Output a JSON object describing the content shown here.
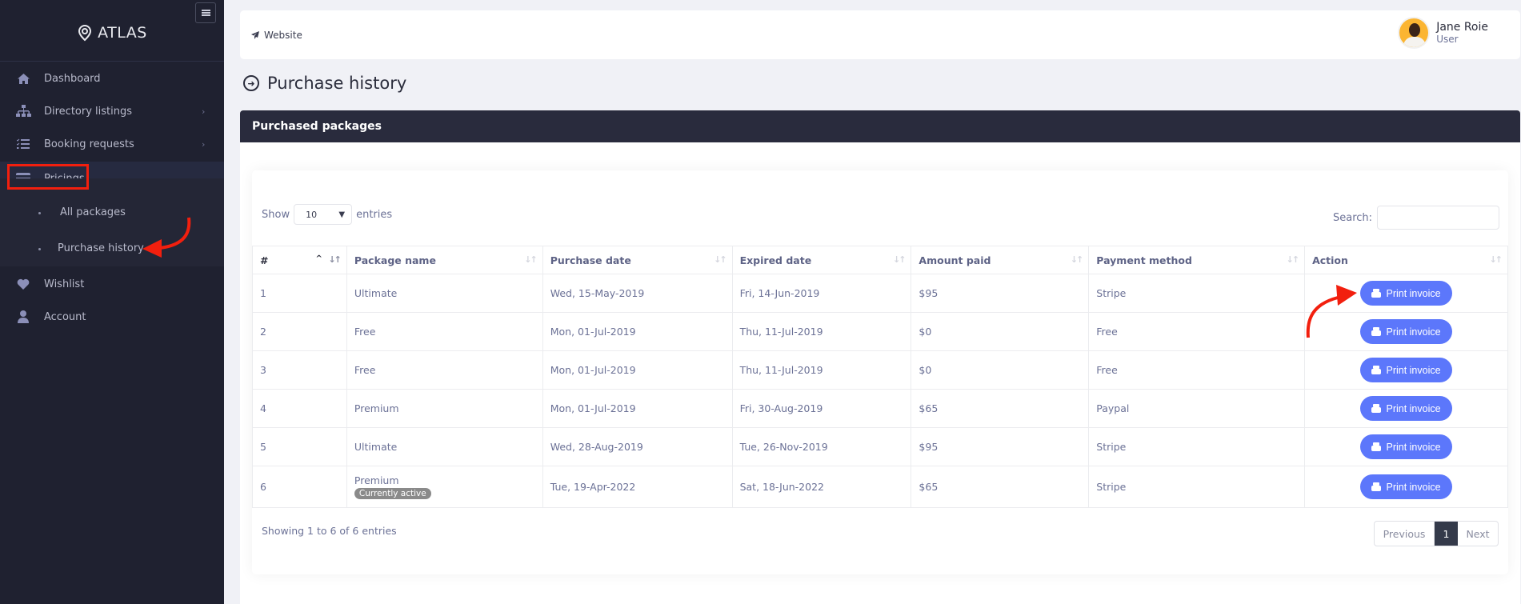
{
  "sidebar": {
    "logo": "ATLAS",
    "items": [
      {
        "label": "Dashboard",
        "icon": "home-icon"
      },
      {
        "label": "Directory listings",
        "icon": "sitemap-icon",
        "has_chevron": true
      },
      {
        "label": "Booking requests",
        "icon": "tasks-icon",
        "has_chevron": true
      },
      {
        "label": "Pricings",
        "icon": "credit-card-icon",
        "expanded": true
      },
      {
        "label": "Wishlist",
        "icon": "heart-icon"
      },
      {
        "label": "Account",
        "icon": "user-icon"
      }
    ],
    "submenu": [
      {
        "label": "All packages"
      },
      {
        "label": "Purchase history",
        "active": true
      }
    ]
  },
  "topbar": {
    "website_label": "Website",
    "user_name": "Jane Roie",
    "user_role": "User"
  },
  "page": {
    "title": "Purchase history",
    "card_title": "Purchased packages"
  },
  "table_controls": {
    "show_label": "Show",
    "entries_label": "entries",
    "page_size": "10",
    "search_label": "Search:",
    "search_value": ""
  },
  "table": {
    "columns": [
      "#",
      "Package name",
      "Purchase date",
      "Expired date",
      "Amount paid",
      "Payment method",
      "Action"
    ],
    "rows": [
      {
        "num": "1",
        "package": "Ultimate",
        "purchase_date": "Wed, 15-May-2019",
        "expired_date": "Fri, 14-Jun-2019",
        "amount": "$95",
        "method": "Stripe",
        "action": "Print invoice"
      },
      {
        "num": "2",
        "package": "Free",
        "purchase_date": "Mon, 01-Jul-2019",
        "expired_date": "Thu, 11-Jul-2019",
        "amount": "$0",
        "method": "Free",
        "action": "Print invoice"
      },
      {
        "num": "3",
        "package": "Free",
        "purchase_date": "Mon, 01-Jul-2019",
        "expired_date": "Thu, 11-Jul-2019",
        "amount": "$0",
        "method": "Free",
        "action": "Print invoice"
      },
      {
        "num": "4",
        "package": "Premium",
        "purchase_date": "Mon, 01-Jul-2019",
        "expired_date": "Fri, 30-Aug-2019",
        "amount": "$65",
        "method": "Paypal",
        "action": "Print invoice"
      },
      {
        "num": "5",
        "package": "Ultimate",
        "purchase_date": "Wed, 28-Aug-2019",
        "expired_date": "Tue, 26-Nov-2019",
        "amount": "$95",
        "method": "Stripe",
        "action": "Print invoice"
      },
      {
        "num": "6",
        "package": "Premium",
        "badge": "Currently active",
        "purchase_date": "Tue, 19-Apr-2022",
        "expired_date": "Sat, 18-Jun-2022",
        "amount": "$65",
        "method": "Stripe",
        "action": "Print invoice"
      }
    ]
  },
  "footer": {
    "info": "Showing 1 to 6 of 6 entries",
    "prev_label": "Previous",
    "current_page": "1",
    "next_label": "Next"
  },
  "colors": {
    "sidebar_bg": "#1f2130",
    "card_header_bg": "#292b3d",
    "button_primary": "#5c77fb",
    "annotation_red": "#f21f0e",
    "badge_gray": "#8a8a8a"
  }
}
